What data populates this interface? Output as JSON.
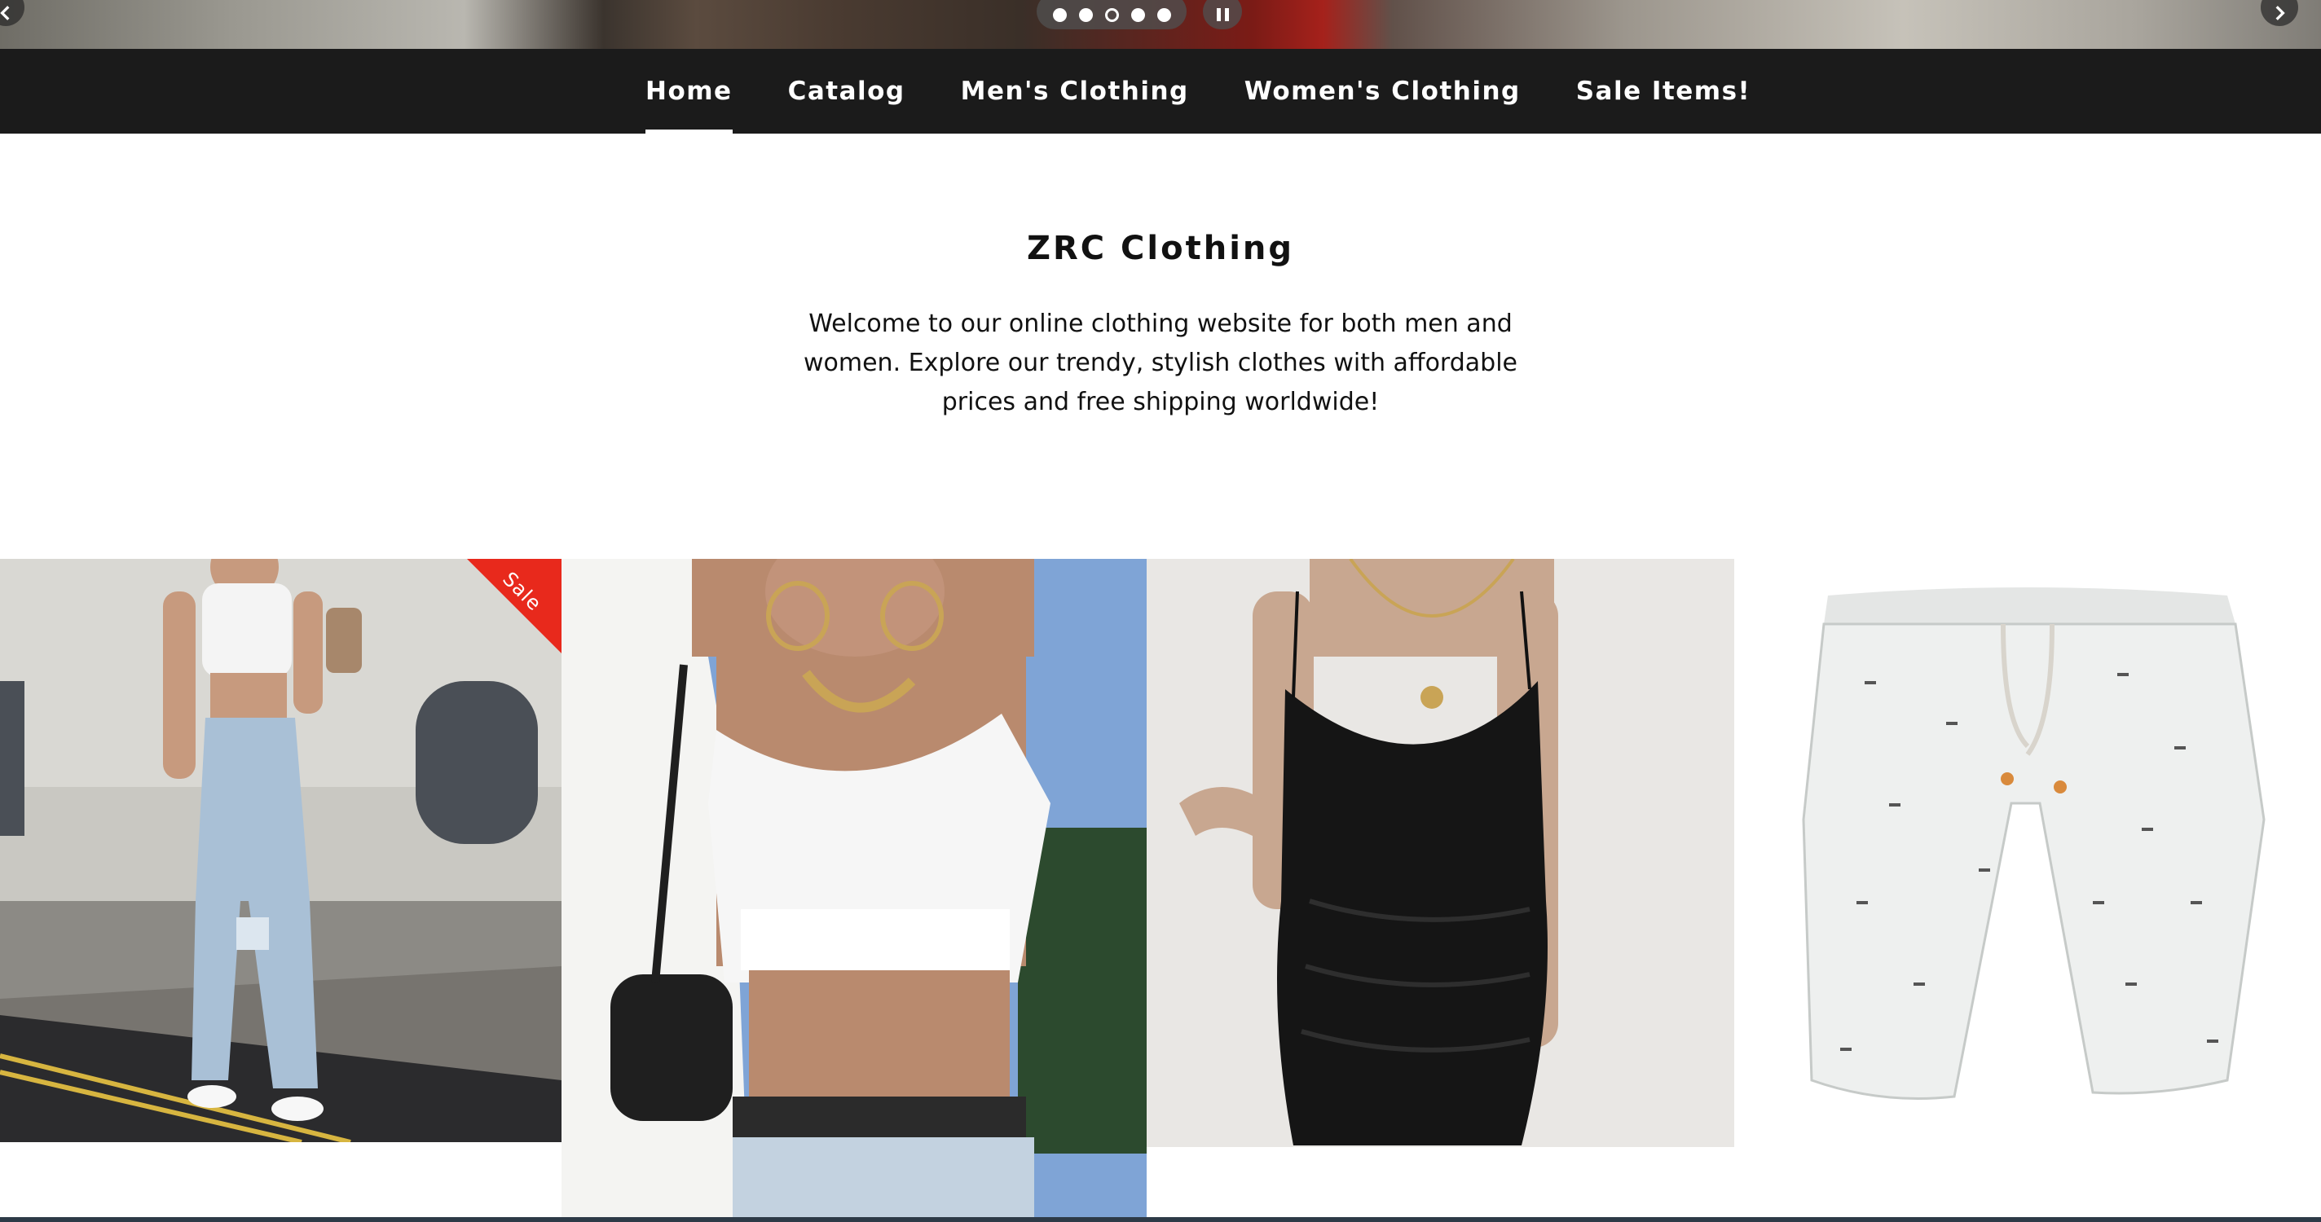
{
  "hero": {
    "prev_icon": "chevron-left-icon",
    "next_icon": "chevron-right-icon",
    "pause_icon": "pause-icon",
    "slides_count": 5,
    "active_slide": 3
  },
  "nav": {
    "items": [
      {
        "label": "Home",
        "active": true
      },
      {
        "label": "Catalog",
        "active": false
      },
      {
        "label": "Men's Clothing",
        "active": false
      },
      {
        "label": "Women's Clothing",
        "active": false
      },
      {
        "label": "Sale Items!",
        "active": false
      }
    ]
  },
  "welcome": {
    "title": "ZRC Clothing",
    "text": "Welcome to our online clothing website for both men and women. Explore our trendy, stylish clothes with affordable prices and free shipping worldwide!"
  },
  "products": [
    {
      "badge": "Sale",
      "image": "woman in white crop top and ripped jeans"
    },
    {
      "badge": "",
      "image": "white lace-up crop top with belt"
    },
    {
      "badge": "",
      "image": "black satin ruched slip dress"
    },
    {
      "badge": "",
      "image": "white printed drawstring shorts"
    }
  ],
  "colors": {
    "nav_bg": "#1b1b1b",
    "sale_badge": "#e8291c",
    "footer_line": "#2d3a47"
  }
}
